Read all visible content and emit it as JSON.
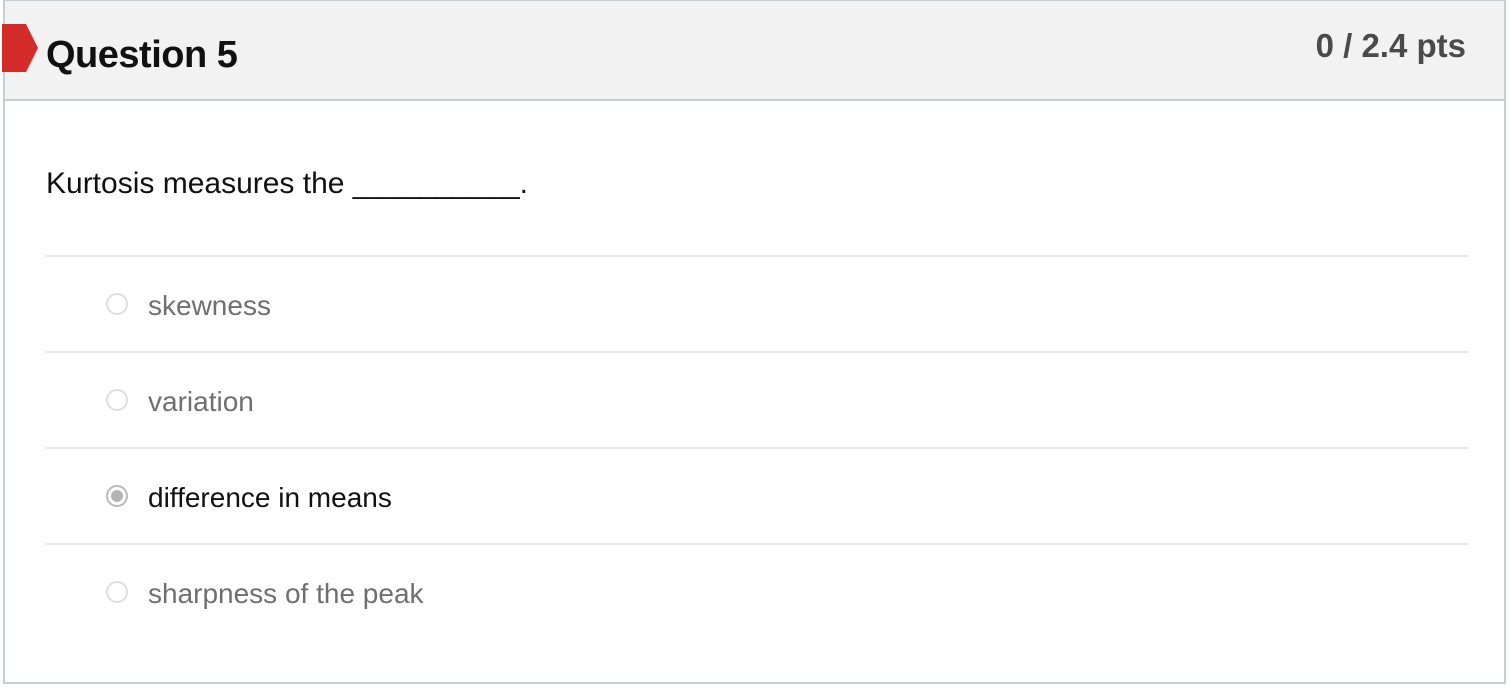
{
  "question": {
    "title": "Question 5",
    "points": "0 / 2.4 pts",
    "text": "Kurtosis measures the __________.",
    "status_flag_color": "#d32a2a"
  },
  "answers": [
    {
      "label": "skewness",
      "selected": false
    },
    {
      "label": "variation",
      "selected": false
    },
    {
      "label": "difference in means",
      "selected": true
    },
    {
      "label": "sharpness of the peak",
      "selected": false
    }
  ]
}
